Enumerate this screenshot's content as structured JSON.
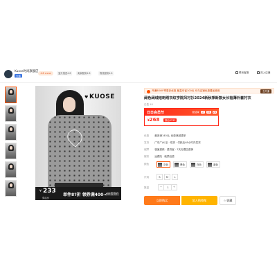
{
  "header": {
    "shop_name": "Kuose时尚旗舰店",
    "shop_badge": "天猫",
    "rating": "4.8 ★★★",
    "tags": [
      "宝贝描述4.8",
      "卖家服务4.8",
      "物流服务4.8"
    ],
    "right_links": [
      "联系客服",
      "进入店铺"
    ]
  },
  "gallery": {
    "thumbs_count": 6,
    "main_image": {
      "brand": "KUOSE",
      "price_currency": "¥",
      "price": "233",
      "coupon_text": "券后价",
      "promo_text": "单件8?折 领券满400-40",
      "badge": "88会员价"
    }
  },
  "product": {
    "promo_banner": {
      "text": "开通88VIP享更多优惠 最高可省100元 可与店铺优惠叠加使用",
      "button": "去开通"
    },
    "title": "阔色阔绒结刺绣衣纹学院风衬衫2024新秋季新款女长袖薄外套衬衣",
    "sales": "已售 40",
    "deal": {
      "label": "日日会员节",
      "countdown_prefix": "距结束",
      "countdown": [
        "17",
        "55",
        "28"
      ],
      "price_prefix": "¥",
      "price": "268",
      "coupon": "券后¥233"
    },
    "info": [
      {
        "label": "优惠",
        "value": "最多满140元, 优惠满减凑单"
      },
      {
        "label": "发货",
        "value": "广东广州  至 · 现货 · 付款后48小时内发货"
      },
      {
        "label": "保障",
        "value": "极速退款 · 退货宝 · 7天无理由退换"
      },
      {
        "label": "服务",
        "value": "运费险 · 破损包退"
      }
    ],
    "style_label": "颜色",
    "styles": [
      "灰色",
      "黑色",
      "白色",
      "蓝色"
    ],
    "size_label": "尺码",
    "sizes": [
      "S",
      "M",
      "L"
    ],
    "qty_label": "数量",
    "qty_value": "1",
    "buttons": {
      "buy": "立即购买",
      "cart": "加入购物车",
      "fav": "☆ 收藏"
    }
  }
}
